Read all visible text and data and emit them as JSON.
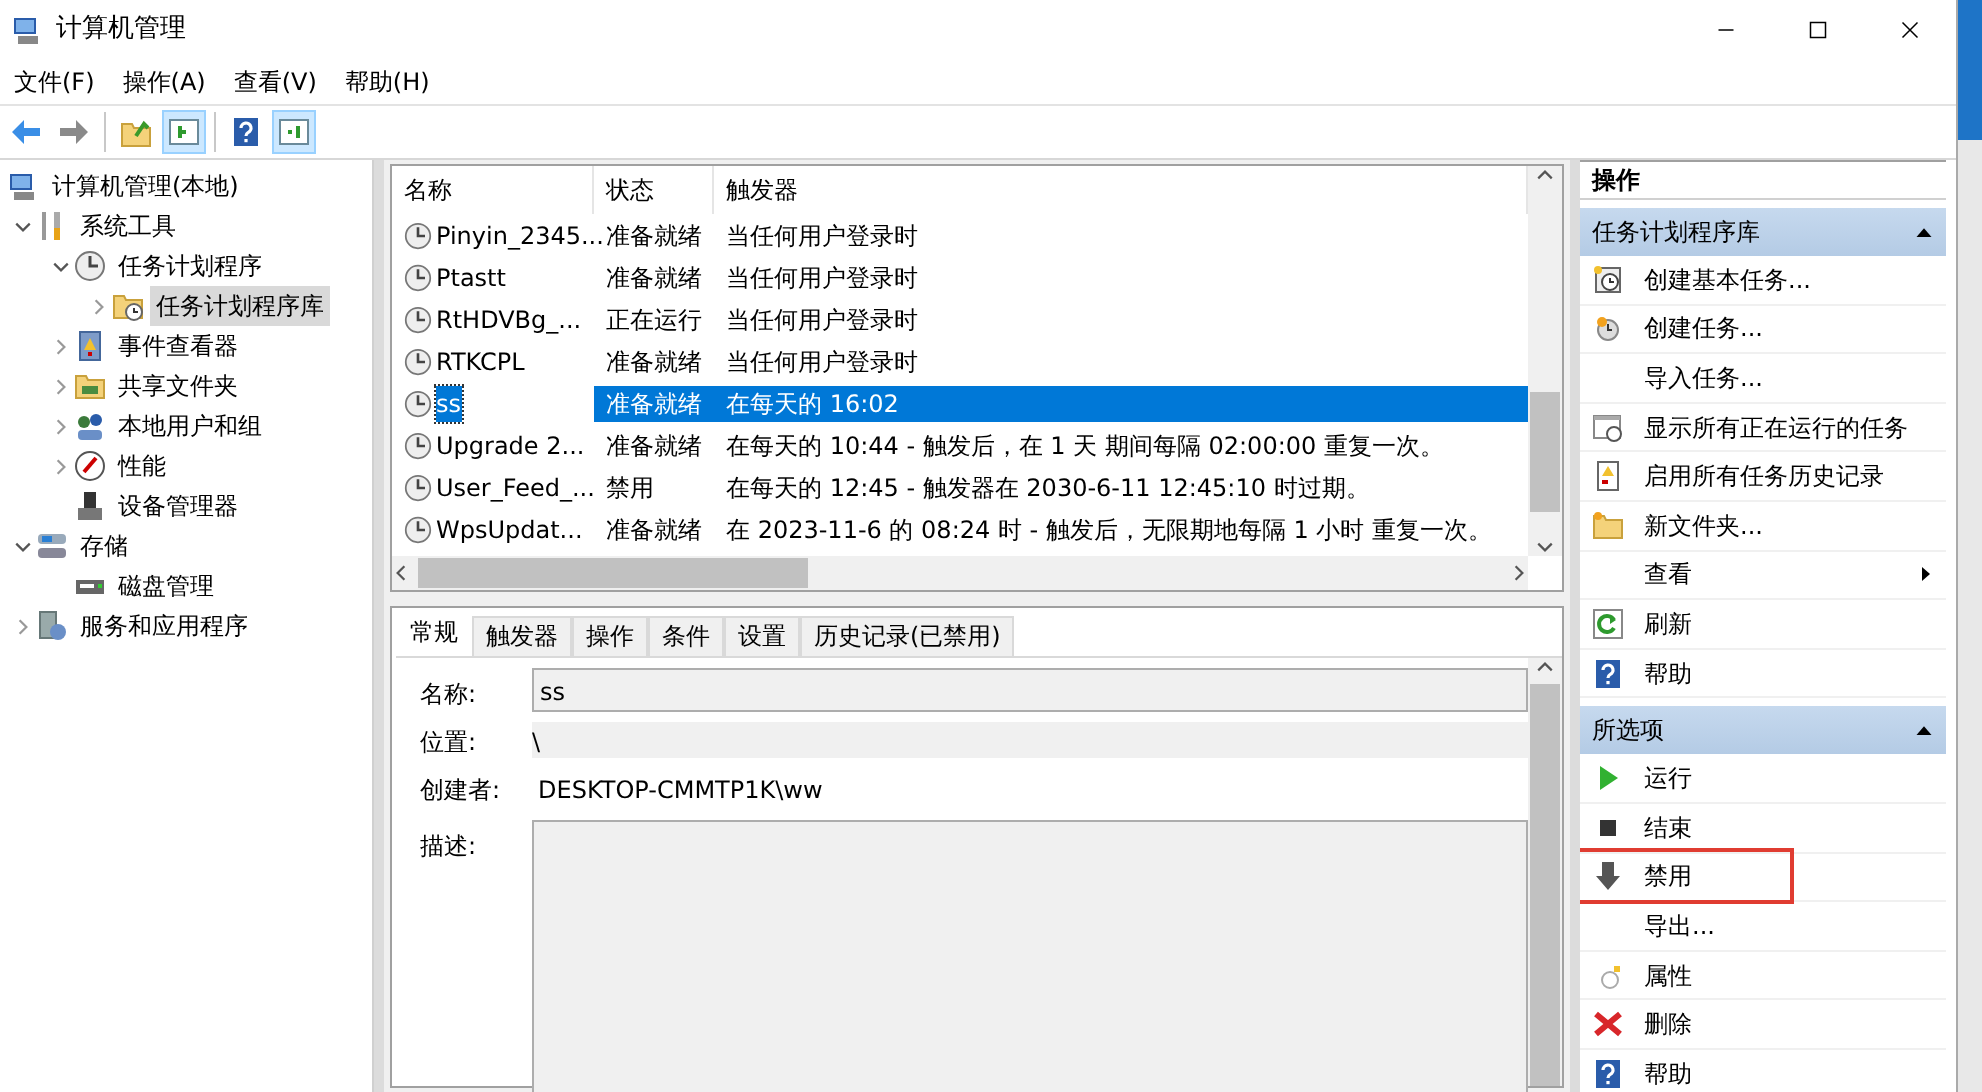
{
  "window": {
    "title": "计算机管理"
  },
  "menu": [
    "文件(F)",
    "操作(A)",
    "查看(V)",
    "帮助(H)"
  ],
  "toolbar": [
    [
      {
        "kind": "back",
        "pressed": false
      },
      {
        "kind": "forward",
        "pressed": false
      }
    ],
    [
      {
        "kind": "up",
        "pressed": false
      },
      {
        "kind": "pane-left",
        "pressed": true
      }
    ],
    [
      {
        "kind": "help",
        "pressed": false
      },
      {
        "kind": "pane-right",
        "pressed": true
      }
    ]
  ],
  "tree": [
    {
      "label": "计算机管理(本地)",
      "kind": "computer",
      "selected": false,
      "children": [
        {
          "label": "系统工具",
          "kind": "tools",
          "expanded": true,
          "selected": false,
          "children": [
            {
              "label": "任务计划程序",
              "kind": "clock",
              "expanded": true,
              "selected": false,
              "children": [
                {
                  "label": "任务计划程序库",
                  "kind": "folder-clock",
                  "expanded": false,
                  "selected": true
                }
              ]
            },
            {
              "label": "事件查看器",
              "kind": "event",
              "expanded": false,
              "selected": false
            },
            {
              "label": "共享文件夹",
              "kind": "share",
              "expanded": false,
              "selected": false
            },
            {
              "label": "本地用户和组",
              "kind": "users",
              "expanded": false,
              "selected": false
            },
            {
              "label": "性能",
              "kind": "perf",
              "expanded": false,
              "selected": false
            },
            {
              "label": "设备管理器",
              "kind": "device",
              "selected": false
            }
          ]
        },
        {
          "label": "存储",
          "kind": "storage",
          "expanded": true,
          "selected": false,
          "children": [
            {
              "label": "磁盘管理",
              "kind": "disk",
              "selected": false
            }
          ]
        },
        {
          "label": "服务和应用程序",
          "kind": "services",
          "expanded": false,
          "selected": false
        }
      ]
    }
  ],
  "task_list": {
    "columns": [
      "名称",
      "状态",
      "触发器"
    ],
    "rows": [
      {
        "name": "Pinyin_2345...",
        "status": "准备就绪",
        "trigger": "当任何用户登录时",
        "selected": false
      },
      {
        "name": "Ptastt",
        "status": "准备就绪",
        "trigger": "当任何用户登录时",
        "selected": false
      },
      {
        "name": "RtHDVBg_...",
        "status": "正在运行",
        "trigger": "当任何用户登录时",
        "selected": false
      },
      {
        "name": "RTKCPL",
        "status": "准备就绪",
        "trigger": "当任何用户登录时",
        "selected": false
      },
      {
        "name": "ss",
        "status": "准备就绪",
        "trigger": "在每天的 16:02",
        "selected": true
      },
      {
        "name": "Upgrade 2...",
        "status": "准备就绪",
        "trigger": "在每天的 10:44 - 触发后，在 1 天 期间每隔 02:00:00 重复一次。",
        "selected": false
      },
      {
        "name": "User_Feed_...",
        "status": "禁用",
        "trigger": "在每天的 12:45 - 触发器在 2030-6-11 12:45:10 时过期。",
        "selected": false
      },
      {
        "name": "WpsUpdat...",
        "status": "准备就绪",
        "trigger": "在 2023-11-6 的 08:24 时 - 触发后，无限期地每隔 1 小时 重复一次。",
        "selected": false
      }
    ]
  },
  "detail": {
    "tabs": [
      {
        "label": "常规",
        "selected": true
      },
      {
        "label": "触发器",
        "selected": false
      },
      {
        "label": "操作",
        "selected": false
      },
      {
        "label": "条件",
        "selected": false
      },
      {
        "label": "设置",
        "selected": false
      },
      {
        "label": "历史记录(已禁用)",
        "selected": false
      }
    ],
    "fields": [
      {
        "label": "名称:",
        "value": "ss",
        "kind": "box"
      },
      {
        "label": "位置:",
        "value": "\\",
        "kind": "plain"
      },
      {
        "label": "创建者:",
        "value": "DESKTOP-CMMTP1K\\ww",
        "kind": "text"
      },
      {
        "label": "描述:",
        "kind": "area"
      }
    ]
  },
  "actions": {
    "title": "操作",
    "sections": [
      {
        "title": "任务计划程序库",
        "expanded": true,
        "items": [
          {
            "label": "创建基本任务...",
            "kind": "basic-task",
            "submenu": false,
            "highlighted": false
          },
          {
            "label": "创建任务...",
            "kind": "task",
            "submenu": false,
            "highlighted": false
          },
          {
            "label": "导入任务...",
            "kind": "plain",
            "submenu": false,
            "highlighted": false
          },
          {
            "label": "显示所有正在运行的任务",
            "kind": "running",
            "submenu": false,
            "highlighted": false
          },
          {
            "label": "启用所有任务历史记录",
            "kind": "history",
            "submenu": false,
            "highlighted": false
          },
          {
            "label": "新文件夹...",
            "kind": "folder",
            "submenu": false,
            "highlighted": false
          },
          {
            "label": "查看",
            "kind": "plain",
            "submenu": true,
            "highlighted": false
          },
          {
            "label": "刷新",
            "kind": "refresh",
            "submenu": false,
            "highlighted": false
          },
          {
            "label": "帮助",
            "kind": "help",
            "submenu": false,
            "highlighted": false
          }
        ]
      },
      {
        "title": "所选项",
        "expanded": true,
        "items": [
          {
            "label": "运行",
            "kind": "run",
            "submenu": false,
            "highlighted": false
          },
          {
            "label": "结束",
            "kind": "stop",
            "submenu": false,
            "highlighted": false
          },
          {
            "label": "禁用",
            "kind": "disable",
            "submenu": false,
            "highlighted": true
          },
          {
            "label": "导出...",
            "kind": "plain",
            "submenu": false,
            "highlighted": false
          },
          {
            "label": "属性",
            "kind": "props",
            "submenu": false,
            "highlighted": false
          },
          {
            "label": "删除",
            "kind": "delete",
            "submenu": false,
            "highlighted": false
          },
          {
            "label": "帮助",
            "kind": "help",
            "submenu": false,
            "highlighted": false
          }
        ]
      }
    ]
  }
}
